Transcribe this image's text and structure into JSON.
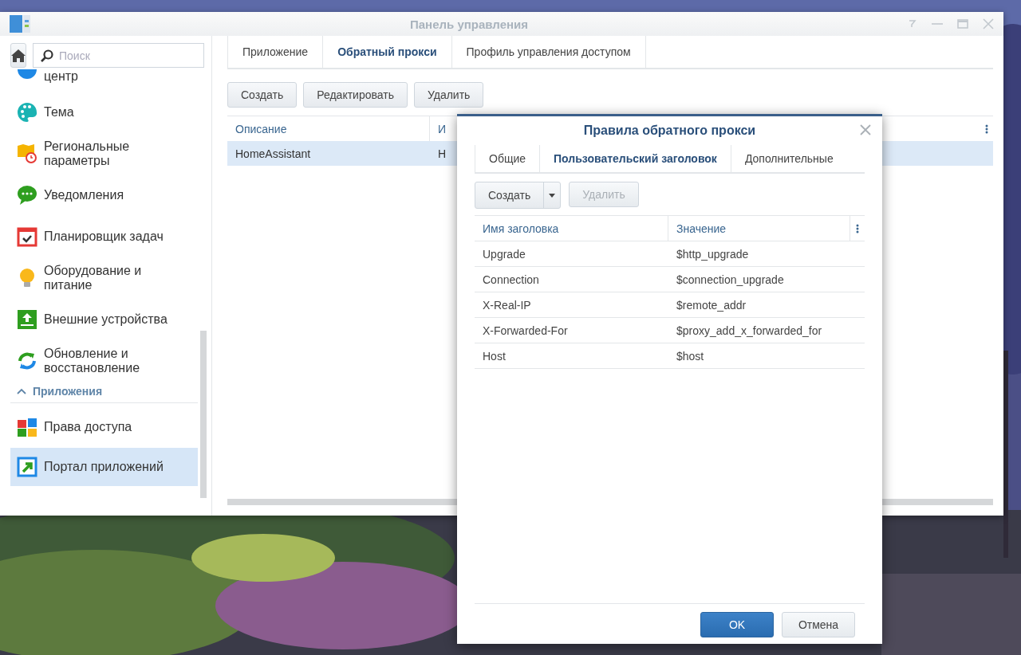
{
  "window": {
    "title": "Панель управления"
  },
  "search": {
    "placeholder": "Поиск"
  },
  "sidebar": {
    "items": [
      {
        "kind": "item",
        "label": "центр",
        "selected": false
      },
      {
        "kind": "item",
        "label": "Тема",
        "selected": false
      },
      {
        "kind": "item",
        "label": "Региональные параметры",
        "selected": false
      },
      {
        "kind": "item",
        "label": "Уведомления",
        "selected": false
      },
      {
        "kind": "item",
        "label": "Планировщик задач",
        "selected": false
      },
      {
        "kind": "item",
        "label": "Оборудование и питание",
        "selected": false
      },
      {
        "kind": "item",
        "label": "Внешние устройства",
        "selected": false
      },
      {
        "kind": "item",
        "label": "Обновление и восстановление",
        "selected": false
      },
      {
        "kind": "section",
        "label": "Приложения",
        "expanded": true
      },
      {
        "kind": "item",
        "label": "Права доступа",
        "selected": false
      },
      {
        "kind": "item",
        "label": "Портал приложений",
        "selected": true
      }
    ]
  },
  "tabs": [
    {
      "label": "Приложение",
      "selected": false
    },
    {
      "label": "Обратный прокси",
      "selected": true
    },
    {
      "label": "Профиль управления доступом",
      "selected": false
    }
  ],
  "toolbar": [
    "Создать",
    "Редактировать",
    "Удалить"
  ],
  "table": {
    "columns": [
      "Описание",
      "И"
    ],
    "rows": [
      {
        "cells": [
          "HomeAssistant",
          "H"
        ],
        "selected": true
      }
    ]
  },
  "dialog": {
    "title": "Правила обратного прокси",
    "tabs": [
      {
        "label": "Общие",
        "selected": false
      },
      {
        "label": "Пользовательский заголовок",
        "selected": true
      },
      {
        "label": "Дополнительные",
        "selected": false
      }
    ],
    "create_button": "Создать",
    "delete_button": {
      "label": "Удалить",
      "disabled": true
    },
    "columns": [
      "Имя заголовка",
      "Значение"
    ],
    "rows": [
      [
        "Upgrade",
        "$http_upgrade"
      ],
      [
        "Connection",
        "$connection_upgrade"
      ],
      [
        "X-Real-IP",
        "$remote_addr"
      ],
      [
        "X-Forwarded-For",
        "$proxy_add_x_forwarded_for"
      ],
      [
        "Host",
        "$host"
      ]
    ],
    "buttons": [
      {
        "label": "OK",
        "kind": "primary"
      },
      {
        "label": "Отмена",
        "kind": "secondary"
      }
    ]
  }
}
